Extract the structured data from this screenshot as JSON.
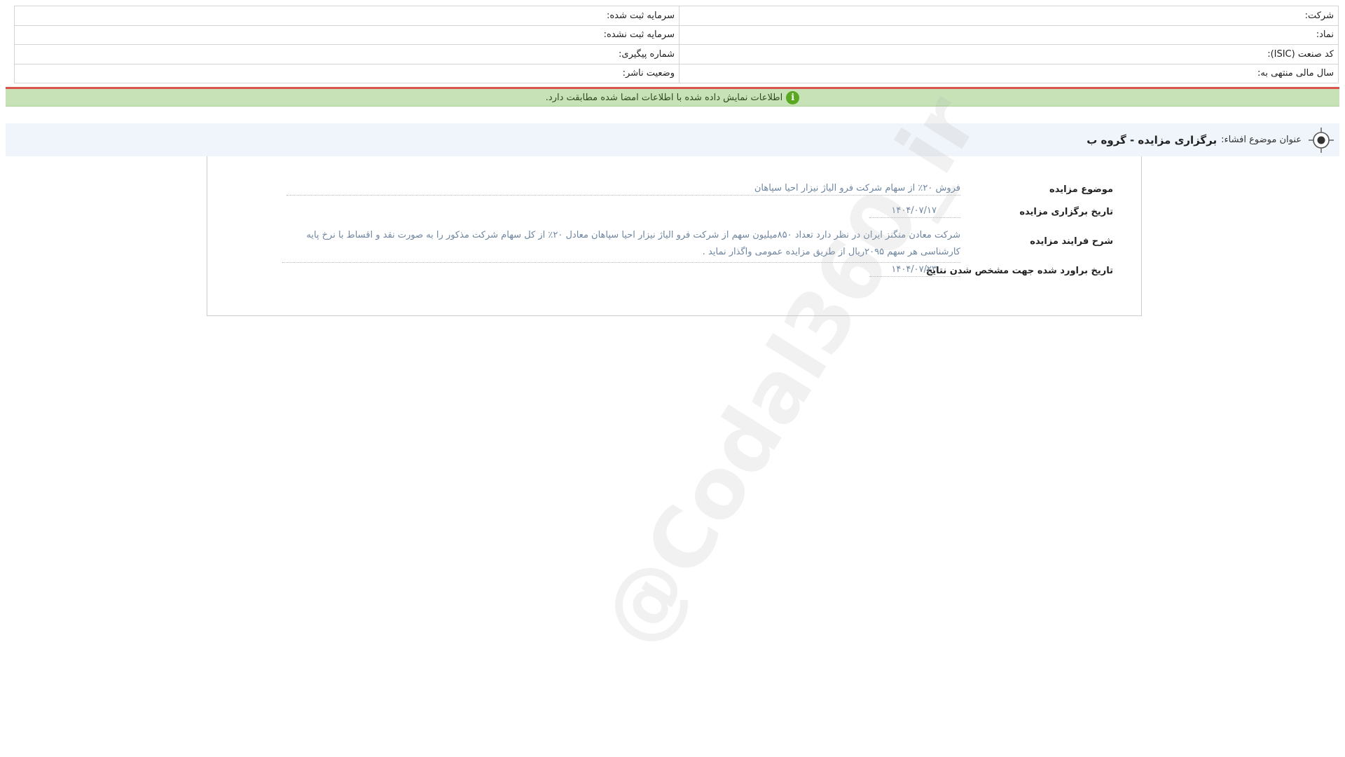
{
  "header": {
    "rows": [
      {
        "right_label": "شرکت:",
        "left_label": "سرمایه ثبت شده:"
      },
      {
        "right_label": "نماد:",
        "left_label": "سرمایه ثبت نشده:"
      },
      {
        "right_label": "کد صنعت (ISIC):",
        "left_label": "شماره پیگیری:"
      },
      {
        "right_label": "سال مالی منتهی به:",
        "left_label": "وضعیت ناشر:"
      }
    ]
  },
  "verification": {
    "message": "اطلاعات نمایش داده شده با اطلاعات امضا شده مطابقت دارد.",
    "icon": "info-icon"
  },
  "subject": {
    "label": "عنوان موضوع افشاء:",
    "value": "برگزاری مزایده - گروه ب",
    "icon": "target-icon"
  },
  "auction": {
    "subject_label": "موضوع مزایده",
    "subject_value": "فروش ۲۰٪ از سهام شرکت فرو الیاژ نیزار احیا سپاهان",
    "date_label": "تاریخ برگزاری مزایده",
    "date_value": "۱۴۰۴/۰۷/۱۷",
    "process_label": "شرح فرایند مزایده",
    "process_value": "شرکت معادن منگنز ایران در نظر دارد تعداد ۸۵۰میلیون سهم از شرکت فرو الیاژ نیزار احیا سپاهان معادل ۲۰٪ از کل سهام شرکت مذکور را به صورت نقد و اقساط با نرخ پایه کارشناسی هر سهم ۲۰۹۵ریال از طریق مزایده عمومی واگذار نماید .",
    "result_date_label": "تاریخ براورد شده جهت مشخص شدن نتایج",
    "result_date_value": "۱۴۰۴/۰۷/۲۳"
  },
  "watermark": "@Codal360_ir",
  "colors": {
    "verify_bg": "#c6e2b6",
    "verify_border": "#d9534f",
    "info_icon": "#5aa821",
    "title_bg": "#eff5fb",
    "value_text": "#6f86a0"
  }
}
